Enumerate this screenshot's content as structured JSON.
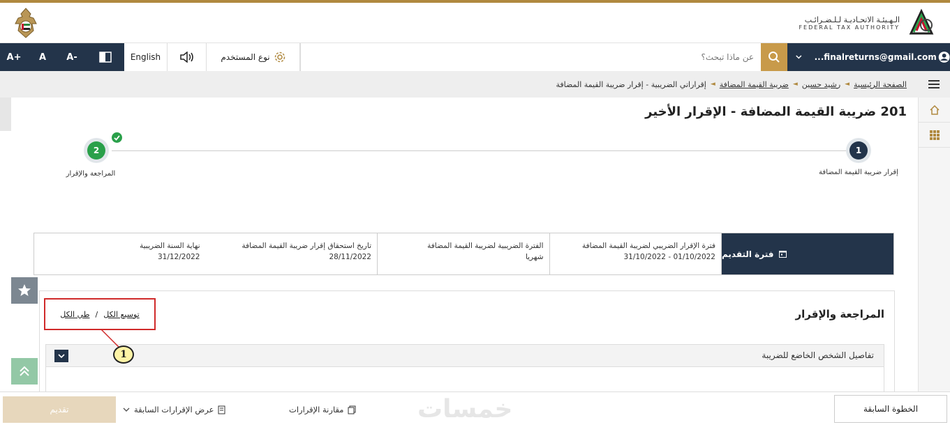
{
  "header": {
    "fta_name_ar": "الـهـيئـة الاتحـاديـة لـلـضـرائـب",
    "fta_name_en": "FEDERAL TAX AUTHORITY"
  },
  "toolbar": {
    "font_increase": "A+",
    "font_normal": "A",
    "font_decrease": "A-",
    "language": "English",
    "user_type": "نوع المستخدم",
    "search_placeholder": "عن ماذا تبحث؟",
    "account_email": "...finalreturns@gmail.com"
  },
  "breadcrumb": {
    "items": [
      "الصفحة الرئيسية",
      "رشيد حسين",
      "ضريبة القيمة المضافة",
      "إقراراتي الضريبية - إقرار ضريبة القيمة المضافة"
    ]
  },
  "page": {
    "title": "201 ضريبة القيمة المضافة - الإقرار الأخير"
  },
  "stepper": {
    "steps": [
      {
        "number": "1",
        "label": "إقرار ضريبة القيمة المضافة"
      },
      {
        "number": "2",
        "label": "المراجعة والإقرار"
      }
    ]
  },
  "info": {
    "header": "فترة التقديم",
    "cells": [
      {
        "label": "فترة الإقرار الضريبي لضريبة القيمة المضافة",
        "value": "01/10/2022 - 31/10/2022"
      },
      {
        "label": "الفترة الضريبية لضريبة القيمة المضافة",
        "value": "شهريا"
      },
      {
        "label": "تاريخ استحقاق إقرار ضريبة القيمة المضافة",
        "value": "28/11/2022"
      },
      {
        "label": "نهاية السنة الضريبية",
        "value": "31/12/2022"
      }
    ]
  },
  "review": {
    "title": "المراجعة والإقرار",
    "expand_all": "توسيع الكل",
    "separator": "/",
    "collapse_all": "طي الكل",
    "section_title": "تفاصيل الشخص الخاضع للضريبة",
    "callout_number": "1"
  },
  "footer": {
    "submit": "تقديم",
    "previous_returns": "عرض الإقرارات السابقة",
    "compare_returns": "مقارنة الإقرارات",
    "previous_step": "الخطوة السابقة",
    "watermark": "خمسات"
  },
  "colors": {
    "navy": "#23344a",
    "gold": "#b0893f",
    "green": "#2aa04a",
    "callout_red": "#d02a2a"
  }
}
